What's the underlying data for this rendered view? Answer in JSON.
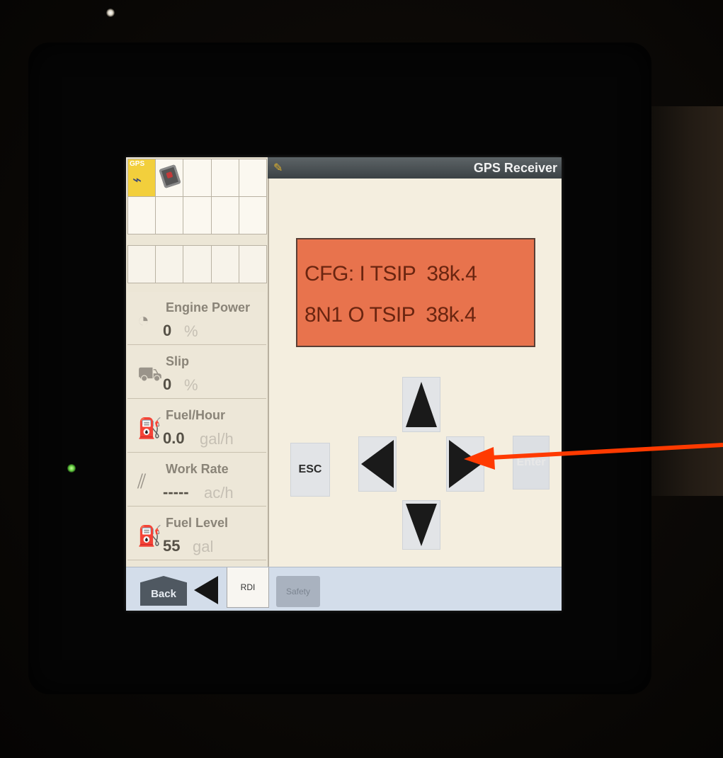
{
  "title": "GPS Receiver",
  "lcd": {
    "line1": "CFG: I TSIP  38k.4",
    "line2": "8N1 O TSIP  38k.4",
    "color": "#e8734d"
  },
  "keypad": {
    "esc_label": "ESC",
    "enter_label": "Enter",
    "up_icon": "up-arrow-icon",
    "down_icon": "down-arrow-icon",
    "left_icon": "left-arrow-icon",
    "right_icon": "right-arrow-icon"
  },
  "shortcuts": {
    "gps_label": "GPS",
    "gps_icon": "gps-receiver-icon",
    "book_icon": "manual-book-icon"
  },
  "gauges": [
    {
      "title": "Engine Power",
      "value": "0",
      "unit": "%",
      "icon": "engine-icon"
    },
    {
      "title": "Slip",
      "value": "0",
      "unit": "%",
      "icon": "tractor-slip-icon"
    },
    {
      "title": "Fuel/Hour",
      "value": "0.0",
      "unit": "gal/h",
      "icon": "fuel-pump-icon"
    },
    {
      "title": "Work Rate",
      "value": "-----",
      "unit": "ac/h",
      "icon": "work-rate-icon"
    },
    {
      "title": "Fuel Level",
      "value": "55",
      "unit": "gal",
      "icon": "fuel-tank-icon"
    }
  ],
  "tabs": {
    "back_label": "Back",
    "rdi_label": "RDI",
    "safety_label": "Safety"
  },
  "annotation": {
    "color": "#ff3a00",
    "icon": "red-arrow-annotation"
  }
}
